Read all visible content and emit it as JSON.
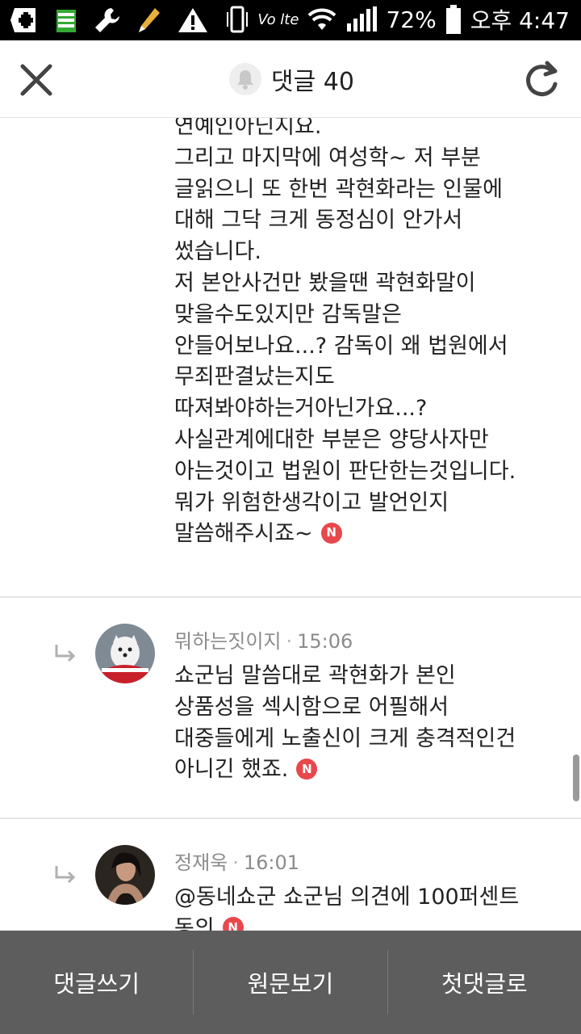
{
  "status_bar": {
    "battery": "72%",
    "time": "오후 4:47",
    "network": "Vo lte"
  },
  "header": {
    "title": "댓글 40"
  },
  "main_comment": {
    "lines": [
      "연예인아닌지요.",
      "그리고 마지막에 여성학~ 저 부분",
      "글읽으니 또 한번 곽현화라는 인물에",
      "대해 그닥 크게 동정심이 안가서",
      "썼습니다.",
      "저 본안사건만 봤을땐 곽현화말이",
      "맞을수도있지만 감독말은",
      "안들어보나요...? 감독이 왜 법원에서",
      "무죄판결났는지도",
      "따져봐야하는거아닌가요...?",
      "사실관계에대한 부분은 양당사자만",
      "아는것이고 법원이 판단한는것입니다.",
      "뭐가 위험한생각이고 발언인지",
      "말씀해주시죠~"
    ],
    "badge": "N"
  },
  "replies": [
    {
      "author": "뭐하는짓이지",
      "time": "15:06",
      "lines": [
        "쇼군님 말씀대로 곽현화가 본인",
        "상품성을 섹시함으로 어필해서",
        "대중들에게 노출신이 크게 충격적인건",
        "아니긴 했죠."
      ],
      "badge": "N"
    },
    {
      "author": "정재욱",
      "time": "16:01",
      "lines": [
        "@동네쇼군  쇼군님 의견에 100퍼센트",
        "동의"
      ],
      "badge": "N"
    }
  ],
  "bottom_bar": {
    "write": "댓글쓰기",
    "original": "원문보기",
    "first": "첫댓글로"
  }
}
